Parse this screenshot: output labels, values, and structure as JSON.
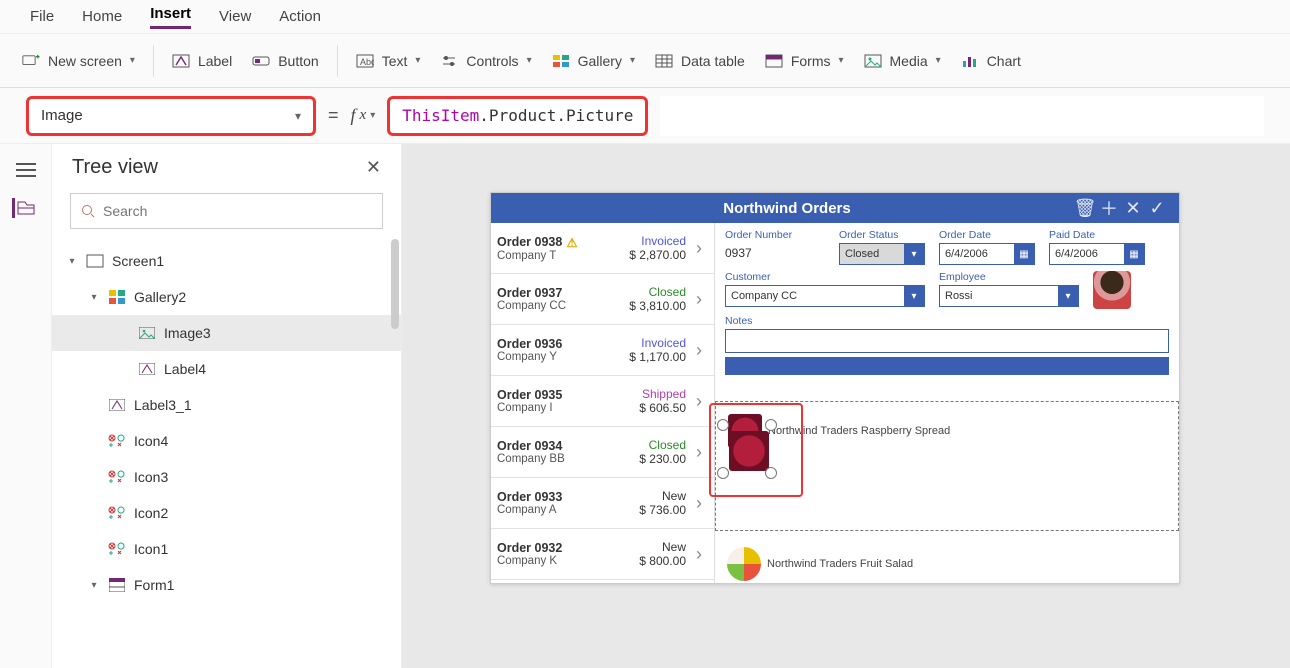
{
  "menu": {
    "items": [
      "File",
      "Home",
      "Insert",
      "View",
      "Action"
    ],
    "active": "Insert"
  },
  "ribbon": {
    "new_screen": "New screen",
    "label": "Label",
    "button": "Button",
    "text": "Text",
    "controls": "Controls",
    "gallery": "Gallery",
    "data_table": "Data table",
    "forms": "Forms",
    "media": "Media",
    "chart": "Chart"
  },
  "property_dropdown": {
    "value": "Image"
  },
  "formula": {
    "token_this": "ThisItem",
    "rest": ".Product.Picture"
  },
  "tree": {
    "title": "Tree view",
    "search_placeholder": "Search",
    "nodes": {
      "screen1": "Screen1",
      "gallery2": "Gallery2",
      "image3": "Image3",
      "label4": "Label4",
      "label3_1": "Label3_1",
      "icon4": "Icon4",
      "icon3": "Icon3",
      "icon2": "Icon2",
      "icon1": "Icon1",
      "form1": "Form1"
    }
  },
  "app": {
    "title": "Northwind Orders",
    "orders": [
      {
        "id": "Order 0938",
        "company": "Company T",
        "amount": "$ 2,870.00",
        "status": "Invoiced",
        "status_cls": "st-inv",
        "warn": true
      },
      {
        "id": "Order 0937",
        "company": "Company CC",
        "amount": "$ 3,810.00",
        "status": "Closed",
        "status_cls": "st-closed"
      },
      {
        "id": "Order 0936",
        "company": "Company Y",
        "amount": "$ 1,170.00",
        "status": "Invoiced",
        "status_cls": "st-inv"
      },
      {
        "id": "Order 0935",
        "company": "Company I",
        "amount": "$ 606.50",
        "status": "Shipped",
        "status_cls": "st-ship"
      },
      {
        "id": "Order 0934",
        "company": "Company BB",
        "amount": "$ 230.00",
        "status": "Closed",
        "status_cls": "st-closed"
      },
      {
        "id": "Order 0933",
        "company": "Company A",
        "amount": "$ 736.00",
        "status": "New",
        "status_cls": "st-new"
      },
      {
        "id": "Order 0932",
        "company": "Company K",
        "amount": "$ 800.00",
        "status": "New",
        "status_cls": "st-new"
      }
    ],
    "detail": {
      "order_number_label": "Order Number",
      "order_number": "0937",
      "order_status_label": "Order Status",
      "order_status": "Closed",
      "order_date_label": "Order Date",
      "order_date": "6/4/2006",
      "paid_date_label": "Paid Date",
      "paid_date": "6/4/2006",
      "customer_label": "Customer",
      "customer": "Company CC",
      "employee_label": "Employee",
      "employee": "Rossi",
      "notes_label": "Notes"
    },
    "gallery_items": {
      "item1": "Northwind Traders Raspberry Spread",
      "item2": "Northwind Traders Fruit Salad"
    }
  }
}
